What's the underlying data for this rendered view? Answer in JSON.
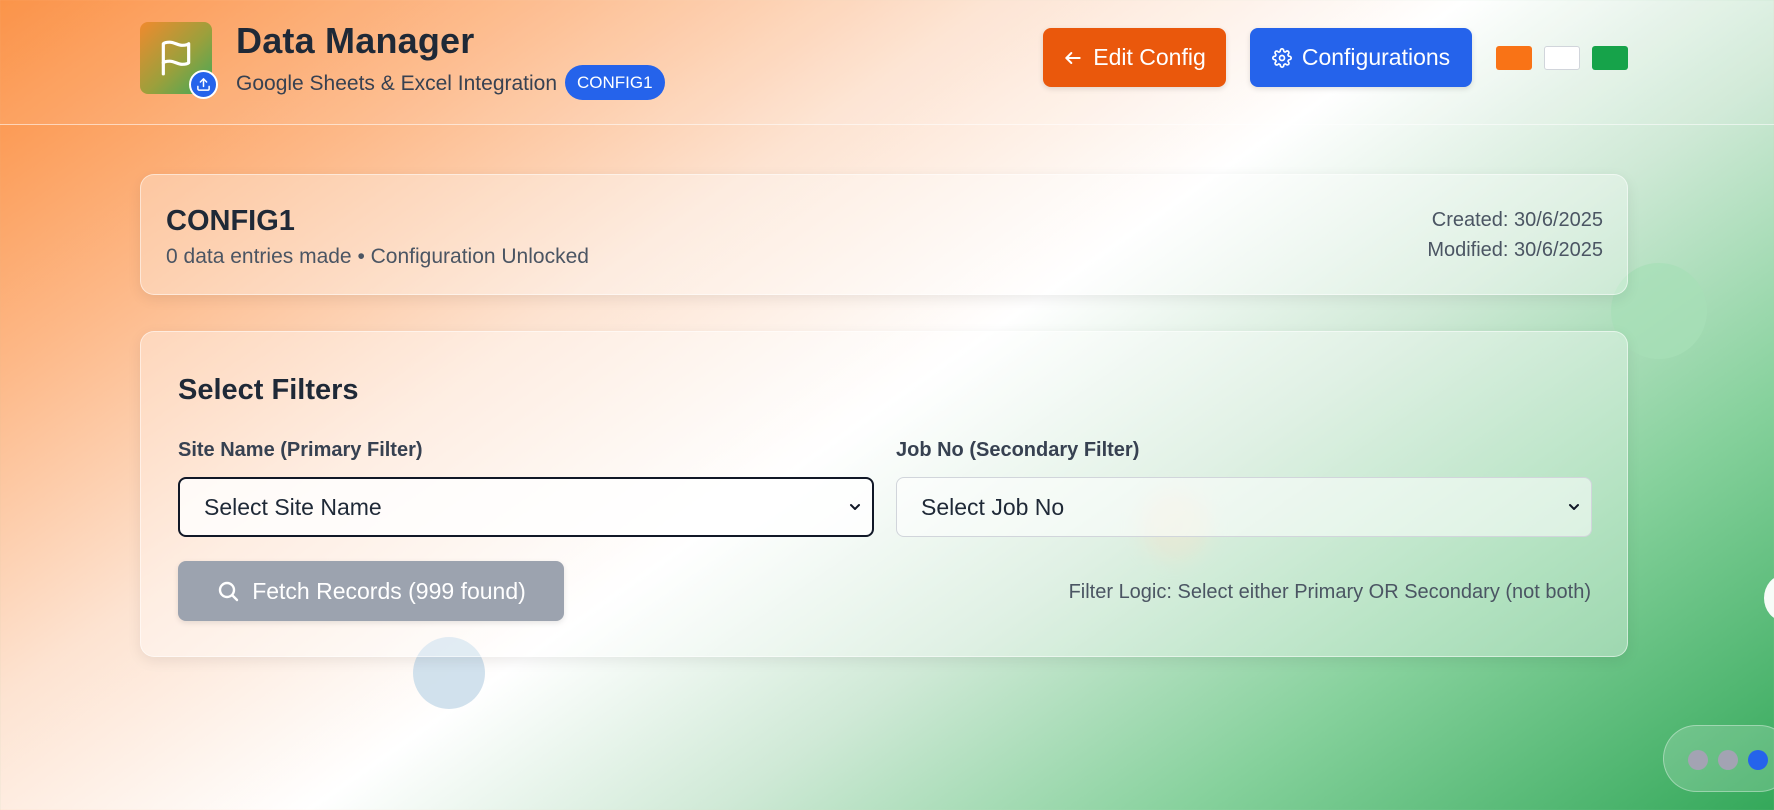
{
  "header": {
    "title": "Data Manager",
    "subtitle": "Google Sheets & Excel Integration",
    "config_badge": "CONFIG1",
    "logo_icon": "flag-icon",
    "badge_icon": "upload-icon",
    "edit_button_label": "Edit Config",
    "edit_button_icon": "arrow-left-icon",
    "configurations_button_label": "Configurations",
    "configurations_button_icon": "gear-icon",
    "theme_swatches": [
      "#f97316",
      "#ffffff",
      "#16a34a"
    ]
  },
  "config_card": {
    "name": "CONFIG1",
    "status": "0 data entries made • Configuration Unlocked",
    "created": "Created: 30/6/2025",
    "modified": "Modified: 30/6/2025"
  },
  "filters": {
    "title": "Select Filters",
    "primary_label": "Site Name (Primary Filter)",
    "primary_value": "Select Site Name",
    "secondary_label": "Job No (Secondary Filter)",
    "secondary_value": "Select Job No",
    "fetch_button_label": "Fetch Records (999 found)",
    "fetch_button_icon": "search-icon",
    "logic_note": "Filter Logic: Select either Primary OR Secondary (not both)"
  },
  "pagination": {
    "dot_count": 3,
    "active_index": 2
  },
  "colors": {
    "accent_blue": "#2563eb",
    "accent_orange": "#ea580c",
    "disabled_gray": "#9ca3af"
  }
}
